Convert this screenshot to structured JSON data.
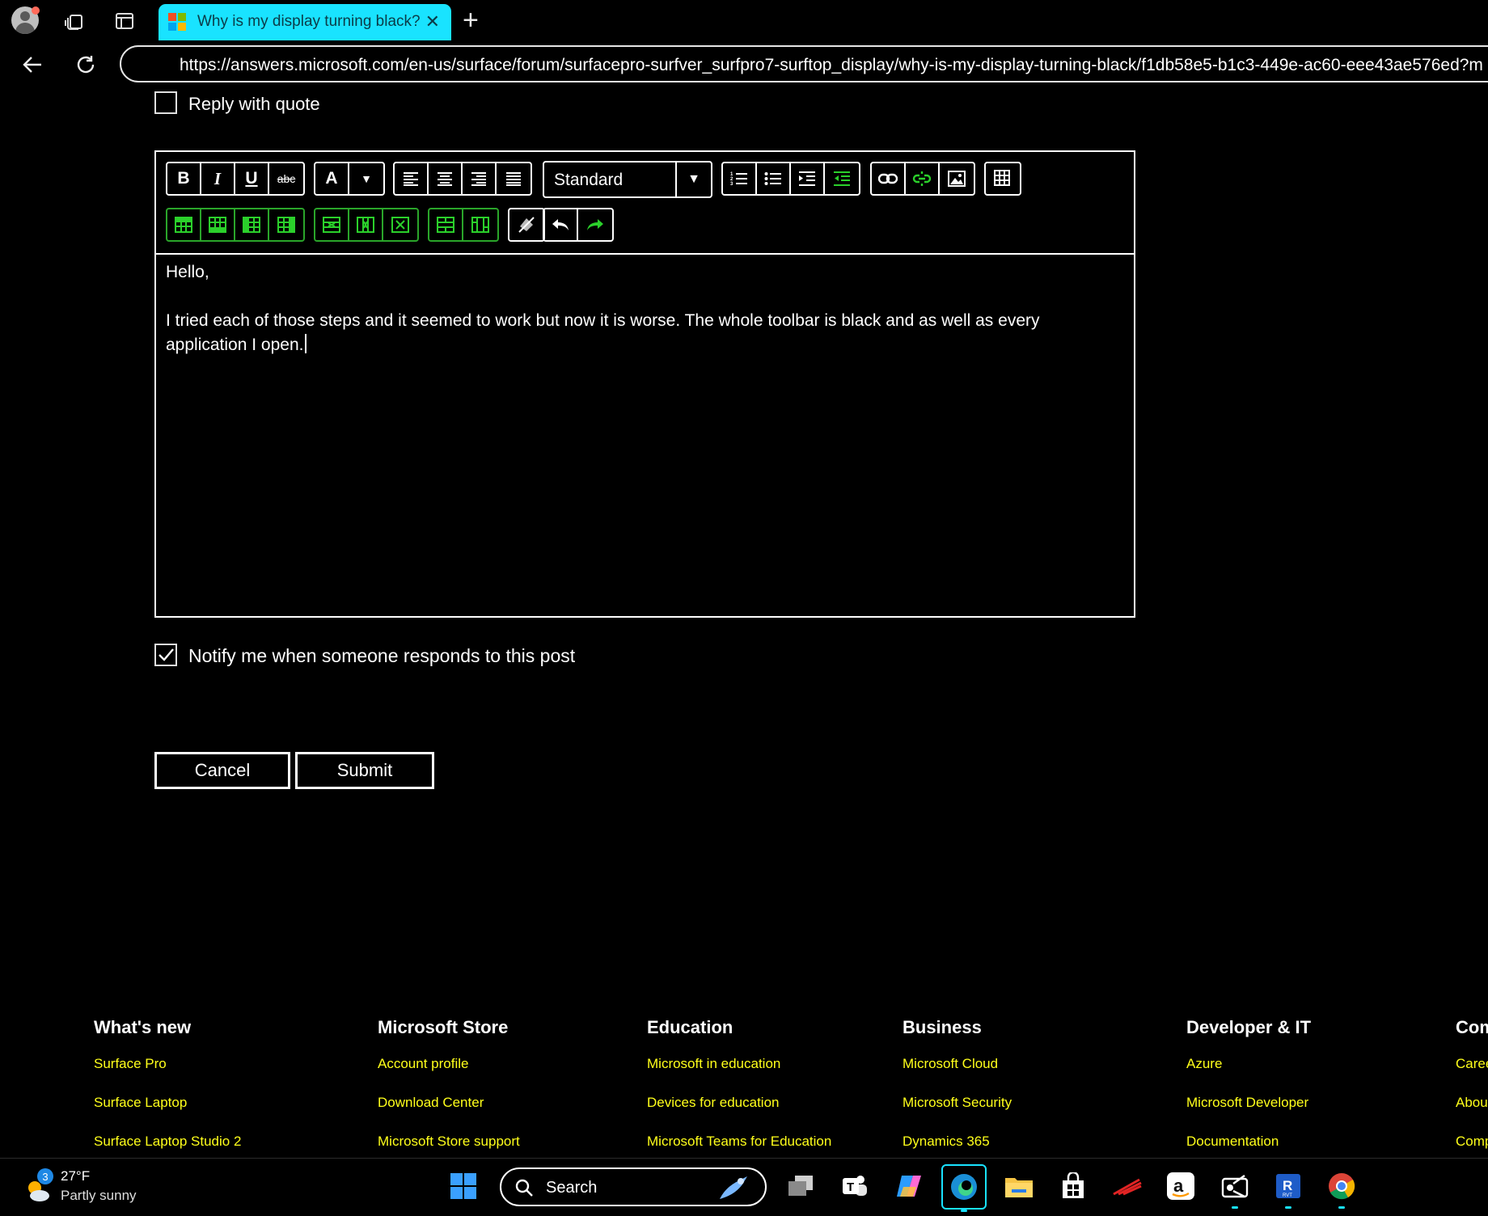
{
  "browser": {
    "tab_title": "Why is my display turning black?",
    "url": "https://answers.microsoft.com/en-us/surface/forum/surfacepro-surfver_surfpro7-surftop_display/why-is-my-display-turning-black/f1db58e5-b1c3-449e-ac60-eee43ae576ed?m",
    "accent": "#19e3ff"
  },
  "reply": {
    "quote_label": "Reply with quote",
    "quote_checked": false
  },
  "editor": {
    "toolbar": {
      "bold": "B",
      "italic": "I",
      "underline": "U",
      "strike": "abc",
      "font_color": "A",
      "paragraph_style": "Standard"
    },
    "body": {
      "line1": "Hello,",
      "line2": "I tried each of those steps and it seemed to work but now it is worse. The whole toolbar is black and as well as every application I open."
    }
  },
  "notify": {
    "label": "Notify me when someone responds to this post",
    "checked": true
  },
  "actions": {
    "cancel": "Cancel",
    "submit": "Submit"
  },
  "footer": {
    "link_color": "#ffff1a",
    "columns": [
      {
        "heading": "What's new",
        "links": [
          "Surface Pro",
          "Surface Laptop",
          "Surface Laptop Studio 2"
        ]
      },
      {
        "heading": "Microsoft Store",
        "links": [
          "Account profile",
          "Download Center",
          "Microsoft Store support"
        ]
      },
      {
        "heading": "Education",
        "links": [
          "Microsoft in education",
          "Devices for education",
          "Microsoft Teams for Education"
        ]
      },
      {
        "heading": "Business",
        "links": [
          "Microsoft Cloud",
          "Microsoft Security",
          "Dynamics 365"
        ]
      },
      {
        "heading": "Developer & IT",
        "links": [
          "Azure",
          "Microsoft Developer",
          "Documentation"
        ]
      },
      {
        "heading": "Com",
        "links": [
          "Caree",
          "Abou",
          "Comp"
        ]
      }
    ]
  },
  "taskbar": {
    "weather_badge": "3",
    "temperature": "27°F",
    "condition": "Partly sunny",
    "search_label": "Search",
    "apps": [
      "start-icon",
      "task-view-icon",
      "teams-icon",
      "copilot-icon",
      "edge-icon",
      "file-explorer-icon",
      "store-icon",
      "app-red-icon",
      "amazon-icon",
      "snipping-icon",
      "revit-icon",
      "chrome-icon"
    ]
  }
}
